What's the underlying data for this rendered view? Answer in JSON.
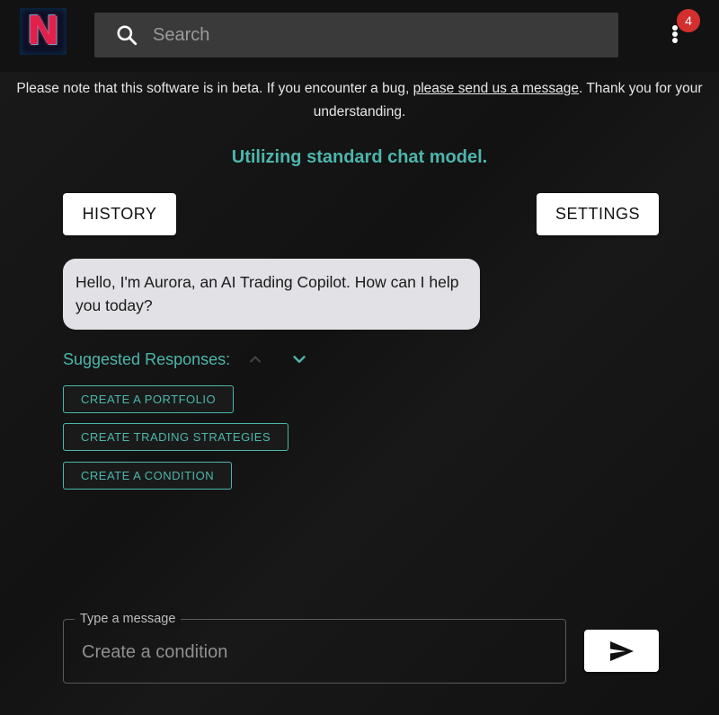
{
  "header": {
    "logo_letter": "N",
    "search": {
      "placeholder": "Search",
      "value": ""
    },
    "icons": {
      "search": "search-icon",
      "menu": "more-vertical-icon"
    },
    "notification_count": "4",
    "colors": {
      "badge": "#d32f2f"
    }
  },
  "notice": {
    "before": "Please note that this software is in beta. If you encounter a bug, ",
    "link": "please send us a message",
    "after": ". Thank you for your understanding."
  },
  "model_status": "Utilizing standard chat model.",
  "buttons": {
    "history": "HISTORY",
    "settings": "SETTINGS"
  },
  "chat": {
    "messages": [
      {
        "sender": "assistant",
        "text": "Hello, I'm Aurora, an AI Trading Copilot. How can I help you today?"
      }
    ]
  },
  "suggestions": {
    "label": "Suggested Responses:",
    "items": [
      "CREATE A PORTFOLIO",
      "CREATE TRADING STRATEGIES",
      "CREATE A CONDITION"
    ],
    "icons": {
      "collapse": "chevron-up-icon",
      "expand": "chevron-down-icon"
    }
  },
  "composer": {
    "label": "Type a message",
    "placeholder": "Create a condition",
    "value": "",
    "send_icon": "send-icon"
  },
  "colors": {
    "accent": "#4db6ac",
    "bubble": "#e1e1e6",
    "background": "#141414"
  }
}
